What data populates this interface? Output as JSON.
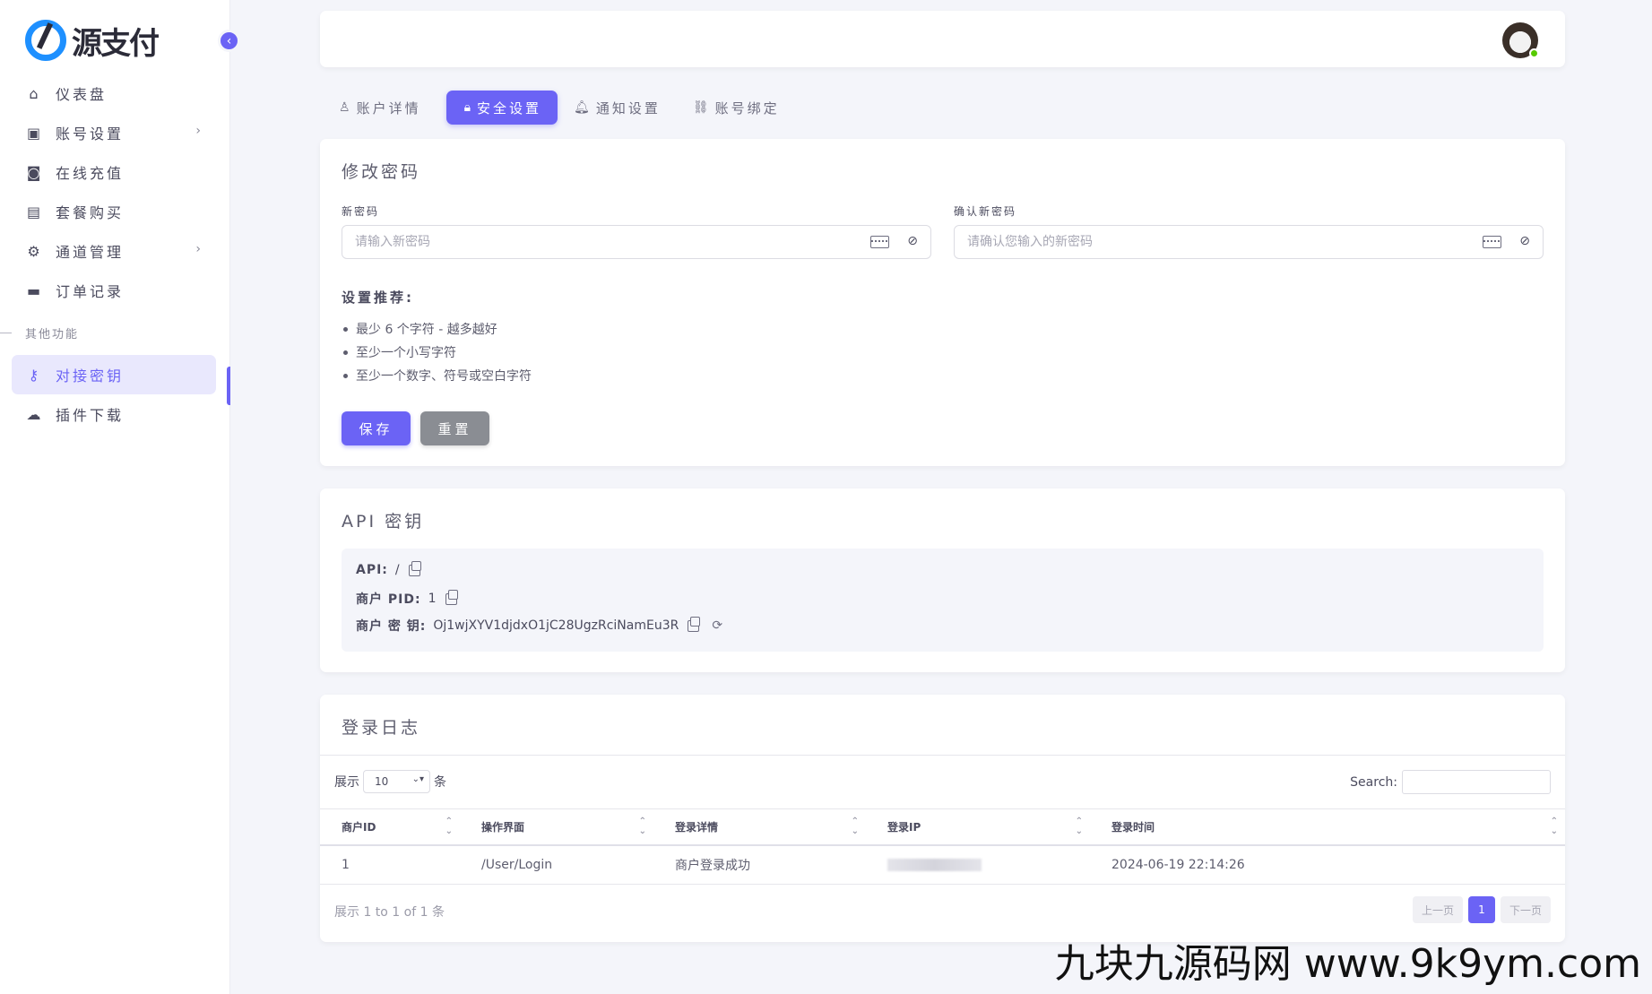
{
  "sidebar": {
    "brand": "源支付",
    "items": [
      {
        "label": "仪表盘",
        "icon": "home-icon"
      },
      {
        "label": "账号设置",
        "icon": "account-box-icon",
        "has_children": true
      },
      {
        "label": "在线充值",
        "icon": "camera-icon"
      },
      {
        "label": "套餐购买",
        "icon": "bag-icon"
      },
      {
        "label": "通道管理",
        "icon": "gear-icon",
        "has_children": true
      },
      {
        "label": "订单记录",
        "icon": "wallet-icon"
      }
    ],
    "section_label": "其他功能",
    "items2": [
      {
        "label": "对接密钥",
        "icon": "key-icon",
        "active": true
      },
      {
        "label": "插件下载",
        "icon": "cloud-download-icon"
      }
    ]
  },
  "tabs": [
    {
      "label": "账户详情",
      "icon": "user-icon"
    },
    {
      "label": "安全设置",
      "icon": "lock-icon",
      "active": true
    },
    {
      "label": "通知设置",
      "icon": "bell-icon"
    },
    {
      "label": "账号绑定",
      "icon": "link-icon"
    }
  ],
  "password": {
    "title": "修改密码",
    "new_label": "新密码",
    "new_placeholder": "请输入新密码",
    "confirm_label": "确认新密码",
    "confirm_placeholder": "请确认您输入的新密码",
    "rec_title": "设置推荐:",
    "rec_items": [
      "最少 6 个字符 - 越多越好",
      "至少一个小写字符",
      "至少一个数字、符号或空白字符"
    ],
    "save_label": "保存",
    "reset_label": "重置"
  },
  "api": {
    "title": "API 密钥",
    "api_key": "API:",
    "api_value": "/",
    "pid_key": "商户 PID:",
    "pid_value": "1",
    "secret_key": "商户 密 钥:",
    "secret_value": "Oj1wjXYV1djdxO1jC28UgzRciNamEu3R"
  },
  "log": {
    "title": "登录日志",
    "show_label": "展示",
    "page_size": "10",
    "unit": "条",
    "search_label": "Search:",
    "columns": [
      "商户ID",
      "操作界面",
      "登录详情",
      "登录IP",
      "登录时间"
    ],
    "rows": [
      {
        "id": "1",
        "page": "/User/Login",
        "detail": "商户登录成功",
        "ip": "",
        "time": "2024-06-19 22:14:26"
      }
    ],
    "info": "展示 1 to 1 of 1 条",
    "prev": "上一页",
    "current_page": "1",
    "next": "下一页"
  },
  "watermark": "九块九源码网 www.9k9ym.com",
  "colors": {
    "accent": "#6b63f5",
    "online": "#56ca00"
  }
}
